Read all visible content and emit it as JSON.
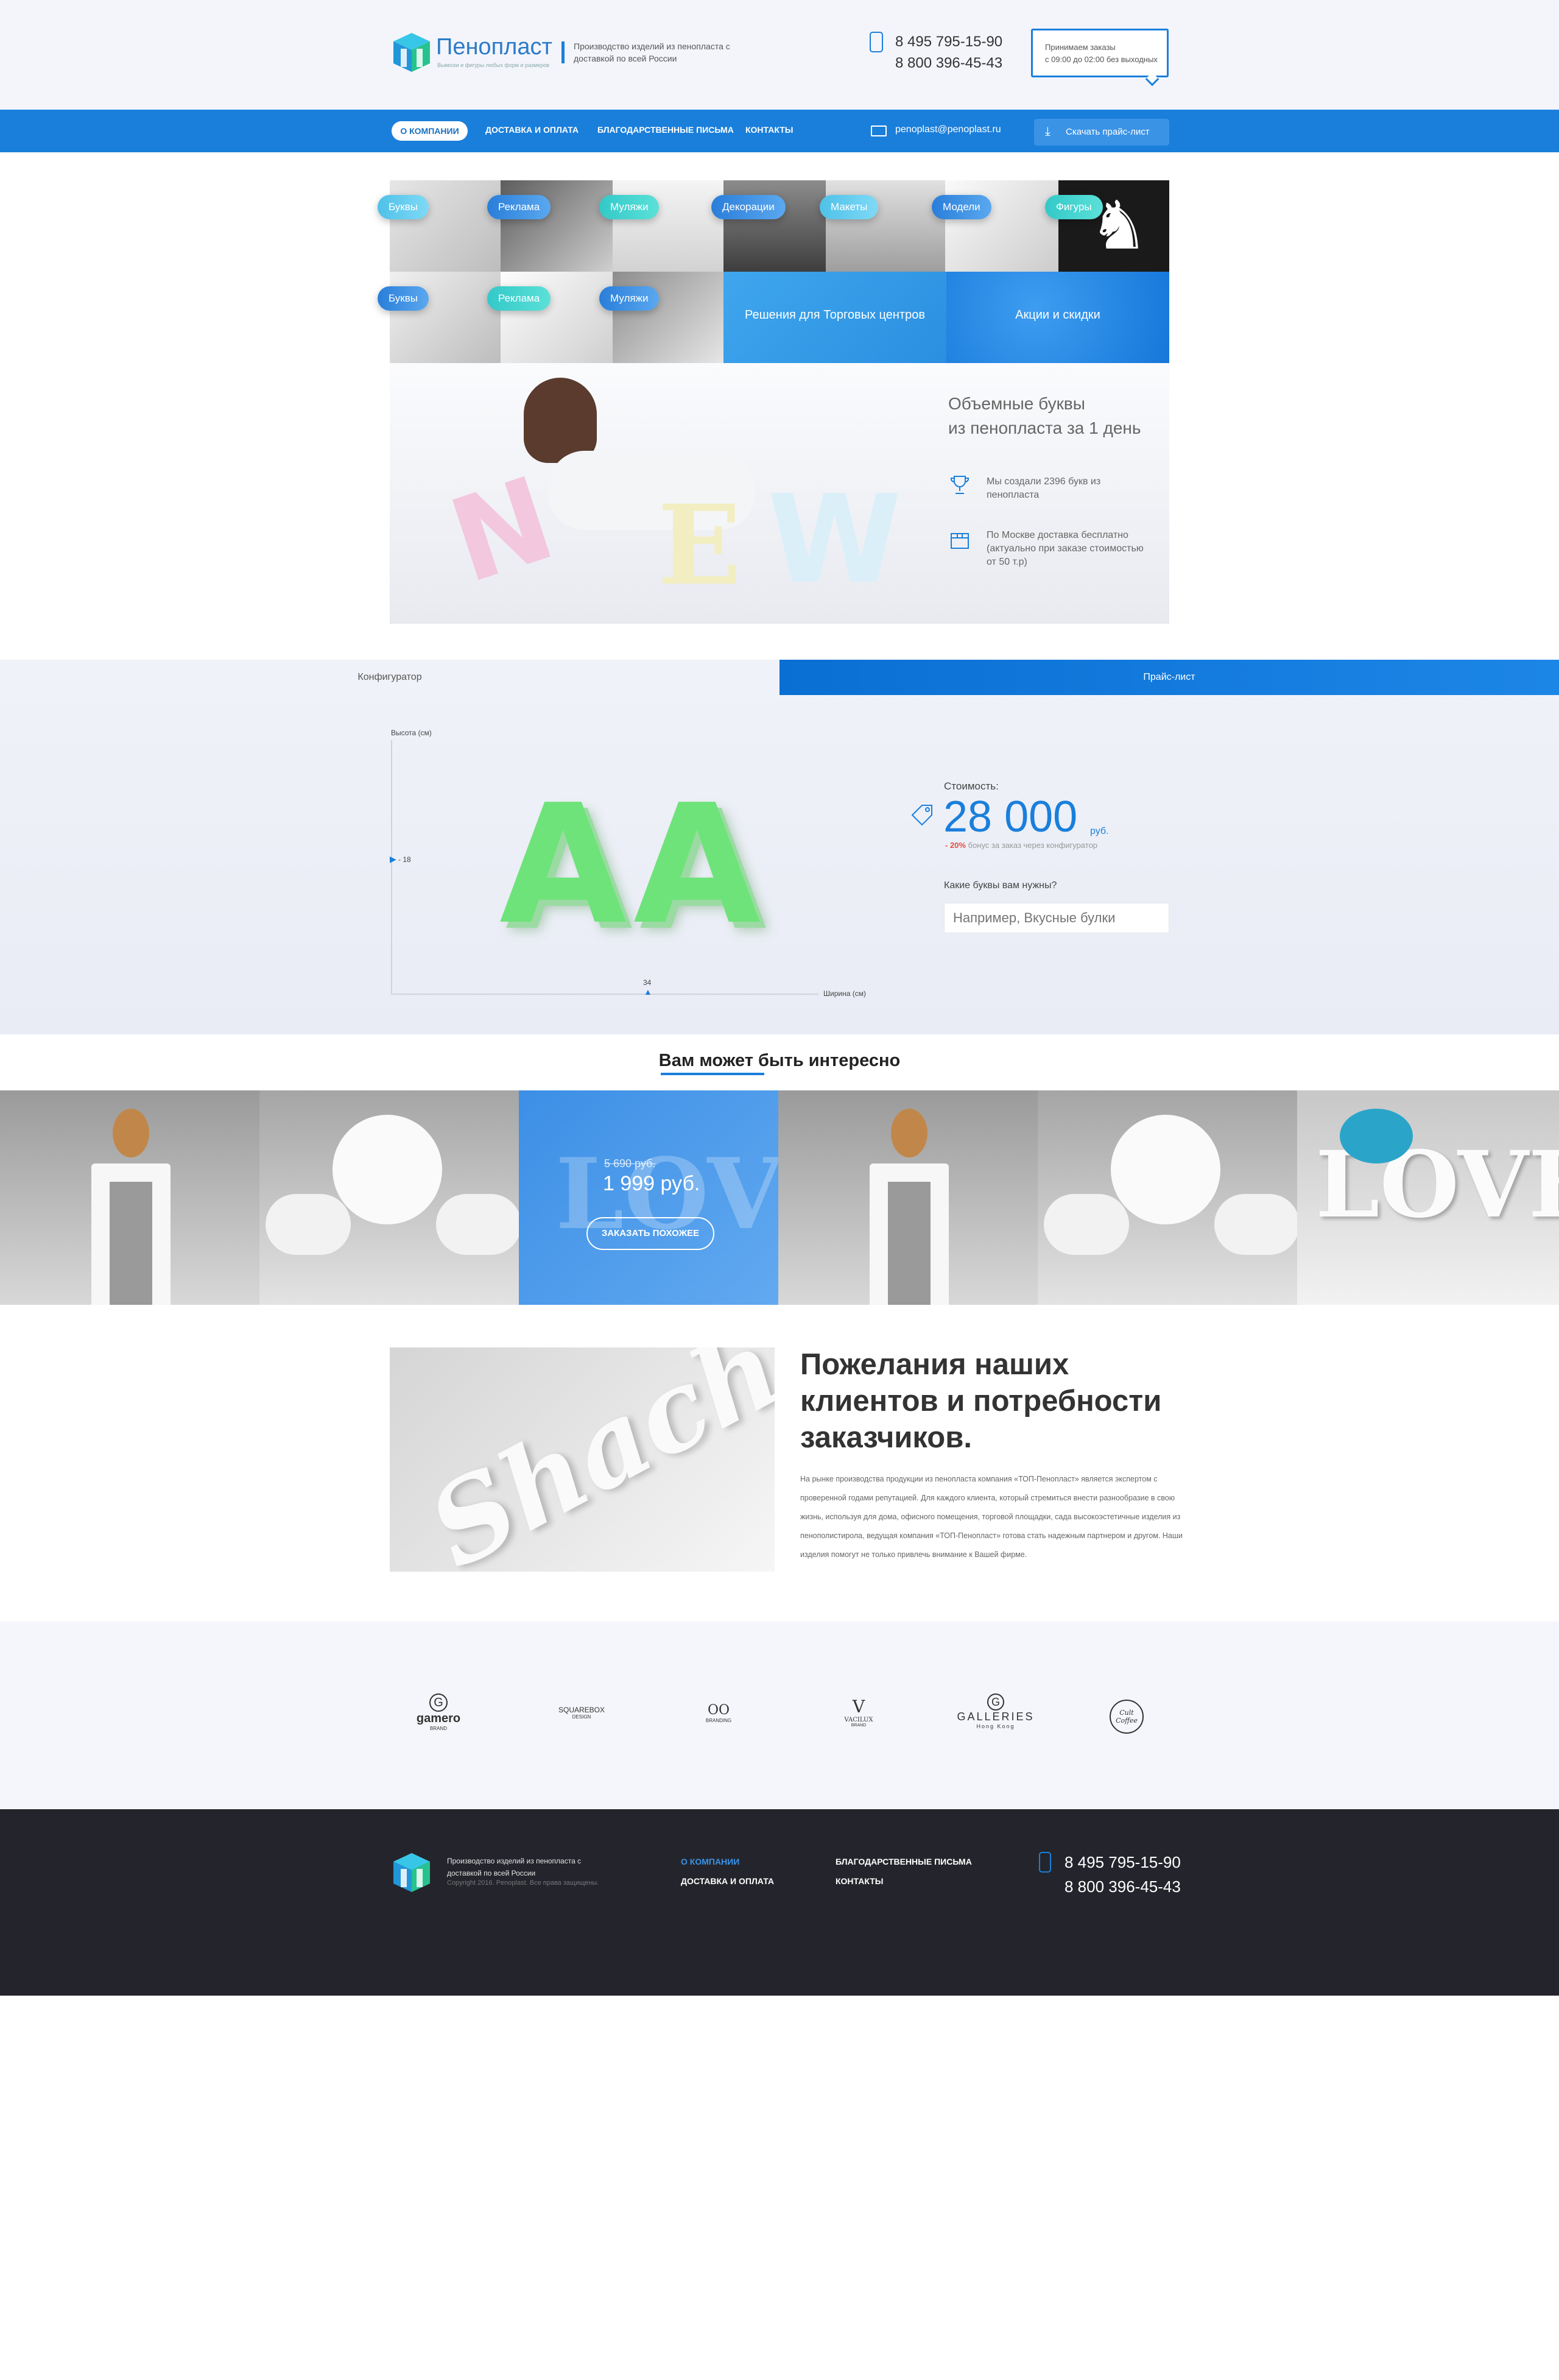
{
  "header": {
    "logo_title": "Пенопласт",
    "logo_subtitle": "Вывески и фигуры любых форм и размеров",
    "tagline": "Производство изделий из пенопласта с доставкой по всей России",
    "phone_1": "8 495 795-15-90",
    "phone_2": "8 800 396-45-43",
    "hours_line_1": "Принимаем заказы",
    "hours_line_2": "с 09:00 до 02:00 без выходных"
  },
  "nav": {
    "items": [
      "О КОМПАНИИ",
      "ДОСТАВКА И ОПЛАТА",
      "БЛАГОДАРСТВЕННЫЕ ПИСЬМА",
      "КОНТАКТЫ"
    ],
    "email": "penoplast@penoplast.ru",
    "price_button": "Скачать прайс-лист"
  },
  "categories": {
    "row1": [
      "Буквы",
      "Реклама",
      "Муляжи",
      "Декорации",
      "Макеты",
      "Модели",
      "Фигуры"
    ],
    "row2": [
      "Буквы",
      "Реклама",
      "Муляжи"
    ],
    "solution_1": "Решения для Торговых центров",
    "solution_2": "Акции и скидки"
  },
  "hero": {
    "title": "Объемные буквы из пенопласта за 1 день",
    "title_line_1": "Объемные буквы",
    "title_line_2": "из пенопласта за 1 день",
    "feature_1": "Мы создали 2396 букв из пенопласта",
    "feature_2": "По Москве доставка бесплатно (актуально при заказе стоимостью от 50 т.р)",
    "image_letters": "NEW"
  },
  "configurator": {
    "tab_configurator": "Конфигуратор",
    "tab_price": "Прайс-лист",
    "y_label": "Высота (см)",
    "x_label": "Ширина (см)",
    "height_value": "18",
    "width_value": "34",
    "preview_letters": [
      "A",
      "A"
    ],
    "cost_label": "Стоимость:",
    "cost_value": "28 000",
    "cost_unit": "руб.",
    "bonus_percent": "- 20%",
    "bonus_text": "бонус за заказ через конфигуратор",
    "question": "Какие буквы вам нужны?",
    "input_placeholder": "Например, Вкусные булки"
  },
  "interesting": {
    "title": "Вам может быть интересно",
    "old_price": "5 690 руб.",
    "new_price": "1 999 руб.",
    "order_button": "ЗАКАЗАТЬ ПОХОЖЕЕ",
    "image_word": "LOVE"
  },
  "wishes": {
    "title_line_1": "Пожелания наших",
    "title_line_2": "клиентов и потребности",
    "title_line_3": "заказчиков.",
    "text": "На рынке производства продукции из пенопласта компания «ТОП-Пенопласт» является экспертом с проверенной годами репутацией. Для каждого клиента, который стремиться внести разнообразие в свою жизнь, используя для дома, офисного помещения, торговой площадки, сада высокоэстетичные изделия из пенополистирола, ведущая компания «ТОП-Пенопласт» готова стать надежным партнером и другом. Наши изделия помогут не только привлечь внимание к Вашей фирме.",
    "image_word": "Shacht"
  },
  "partners": [
    {
      "name": "gamero",
      "sub": "BRAND"
    },
    {
      "name": "SQUAREBOX",
      "sub": "DESIGN"
    },
    {
      "name": "OO",
      "sub": "BRANDING"
    },
    {
      "name": "VACILUX",
      "sub": "BRAND"
    },
    {
      "name": "GALLERIES",
      "sub": "Hong Kong"
    },
    {
      "name": "Cult Coffee",
      "sub": ""
    }
  ],
  "footer": {
    "text": "Производство изделий из пенопласта с доставкой по всей России",
    "copyright": "Copyright 2016. Penoplast. Все права защищены.",
    "links_col_1": [
      "О КОМПАНИИ",
      "ДОСТАВКА И ОПЛАТА"
    ],
    "links_col_2": [
      "БЛАГОДАРСТВЕННЫЕ ПИСЬМА",
      "КОНТАКТЫ"
    ],
    "phone_1": "8 495 795-15-90",
    "phone_2": "8 800 396-45-43"
  },
  "colors": {
    "accent": "#1a7fdb",
    "footer_bg": "#24252c",
    "letter_green": "#6ee37a",
    "promo_red": "#e74c3c"
  }
}
